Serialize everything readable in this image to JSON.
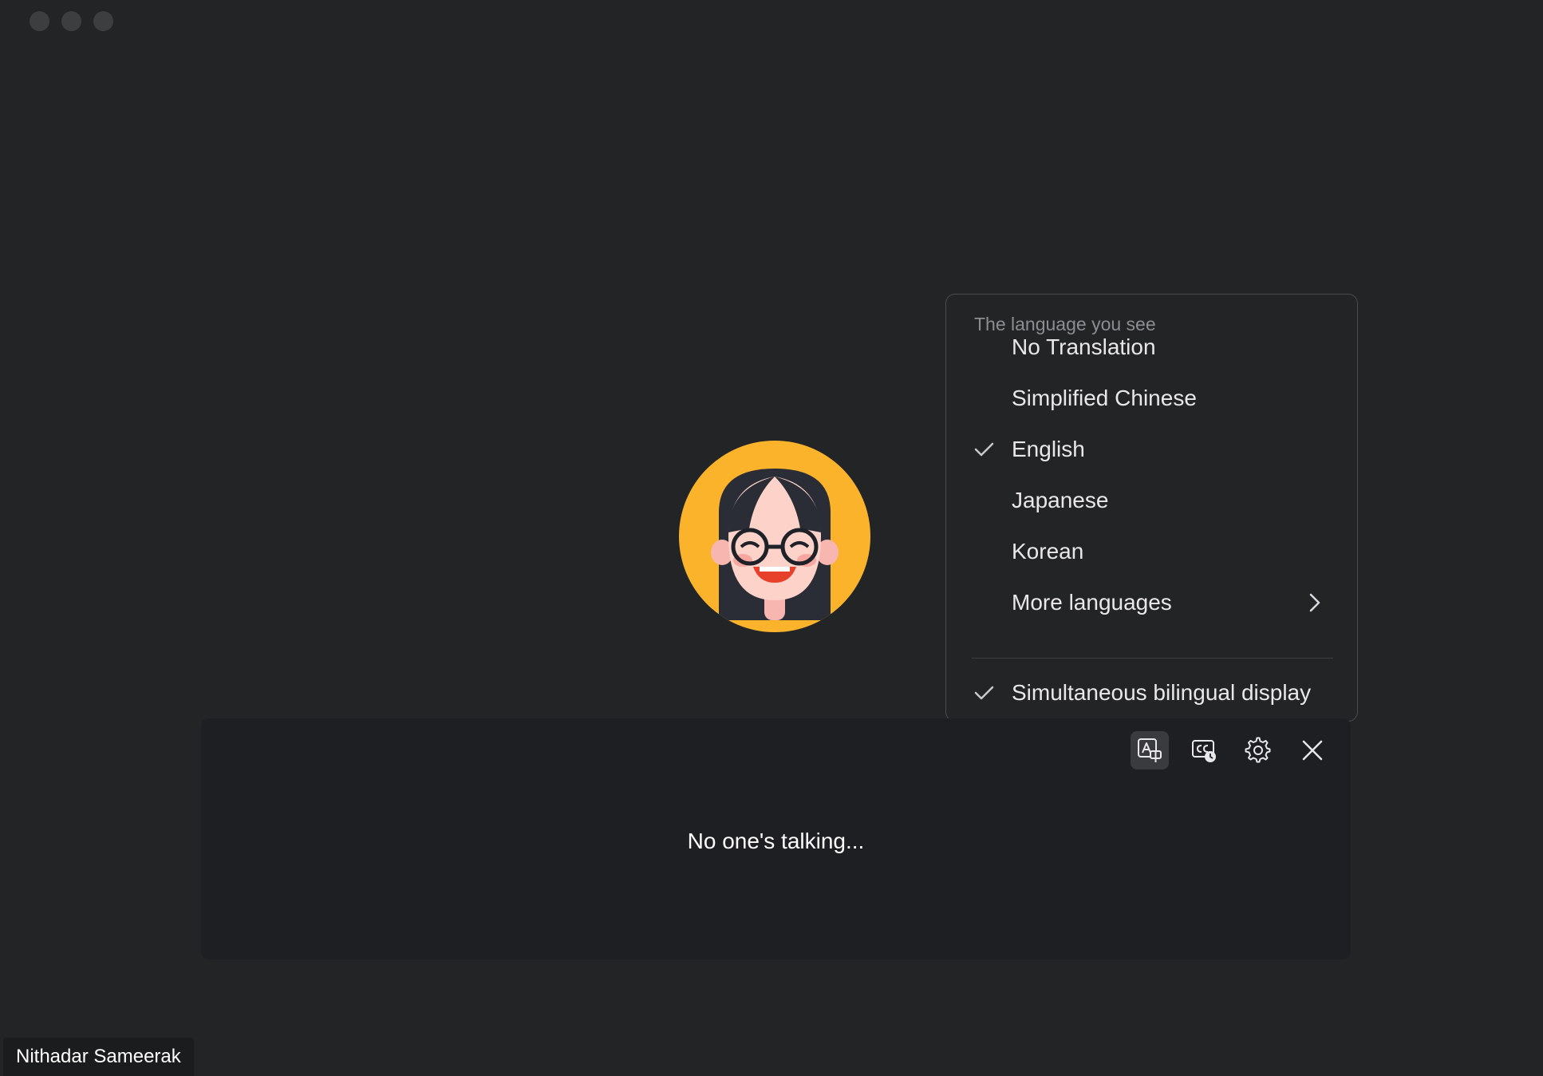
{
  "menu": {
    "header": "The language you see",
    "items": [
      {
        "label": "No Translation",
        "checked": false
      },
      {
        "label": "Simplified Chinese",
        "checked": false
      },
      {
        "label": "English",
        "checked": true
      },
      {
        "label": "Japanese",
        "checked": false
      },
      {
        "label": "Korean",
        "checked": false
      },
      {
        "label": "More languages",
        "checked": false,
        "submenu": true
      }
    ],
    "bilingual": {
      "label": "Simultaneous bilingual display",
      "checked": true
    }
  },
  "captions": {
    "status_text": "No one's talking...",
    "toolbar": [
      "translate-icon",
      "caption-history-icon",
      "gear-icon",
      "close-icon"
    ]
  },
  "participant": {
    "name": "Nithadar Sameerak"
  },
  "colors": {
    "background": "#232426",
    "panel": "#1e1f22",
    "avatar_bg": "#fbb32b",
    "text": "#ffffff"
  }
}
